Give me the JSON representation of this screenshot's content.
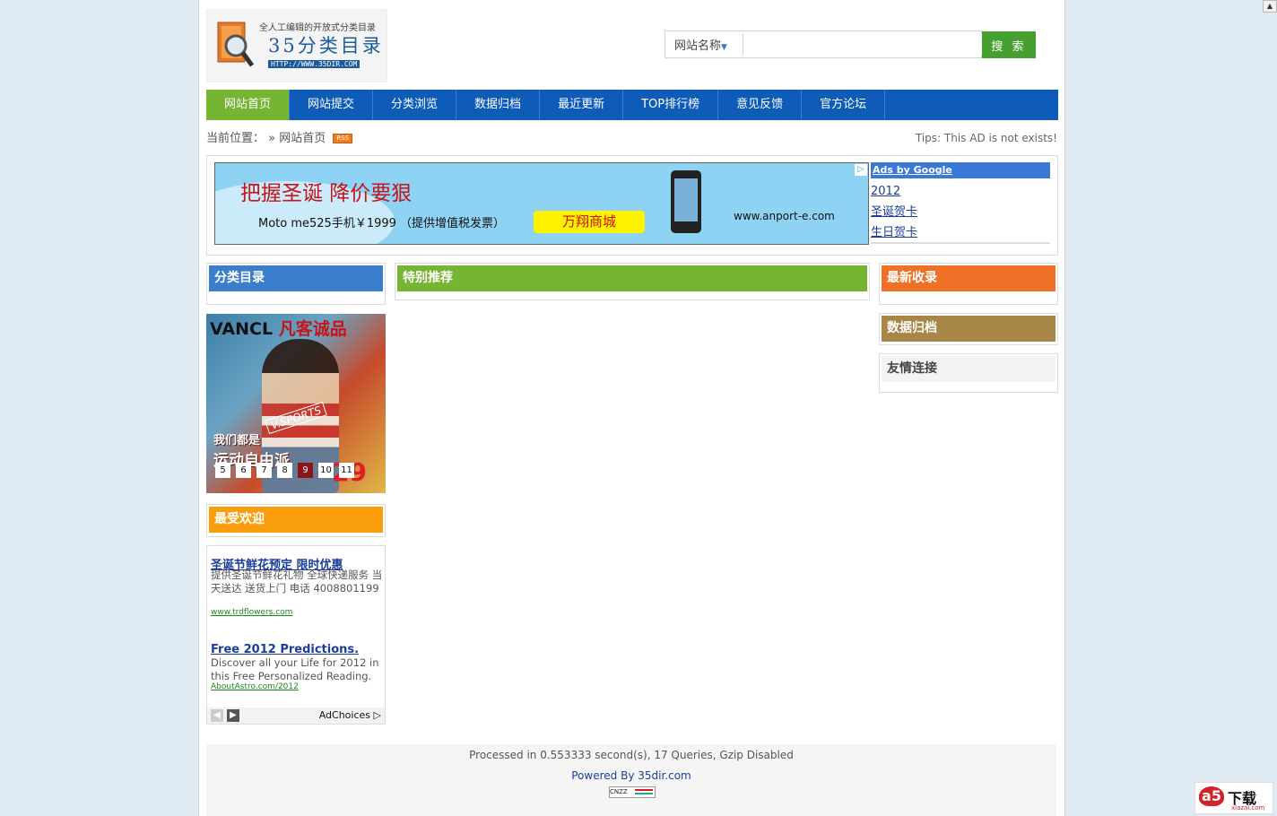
{
  "logo": {
    "slogan": "全人工编辑的开放式分类目录",
    "title": "35分类目录",
    "url": "HTTP://WWW.35DIR.COM"
  },
  "search": {
    "type_selected": "网站名称",
    "placeholder": "",
    "button": "搜 索"
  },
  "nav": {
    "items": [
      "网站首页",
      "网站提交",
      "分类浏览",
      "数据归档",
      "最近更新",
      "TOP排行榜",
      "意见反馈",
      "官方论坛"
    ]
  },
  "breadcrumb": {
    "label": "当前位置：",
    "sep": "»",
    "current": "网站首页",
    "rss": "RSS"
  },
  "tips": "Tips: This AD is not exists!",
  "banner_ad": {
    "headline": "把握圣诞  降价要狠",
    "subline": "Moto me525手机￥1999 （提供增值税发票）",
    "mall": "万翔商城",
    "url": "www.anport-e.com"
  },
  "google_ads": {
    "header": "Ads by Google",
    "links": [
      "2012",
      "圣诞贺卡",
      "生日贺卡"
    ]
  },
  "boxes": {
    "category": "分类目录",
    "featured": "特别推荐",
    "latest": "最新收录",
    "archive": "数据归档",
    "friends": "友情连接",
    "popular": "最受欢迎"
  },
  "vancl_ad": {
    "brand": "VANCL",
    "brand_cn": "凡客诚品",
    "sports": "V.SPORTS",
    "slogan_1": "我们都是",
    "slogan_2": "运动自由派",
    "price": "29",
    "pages": [
      "5",
      "6",
      "7",
      "8",
      "9",
      "10",
      "11"
    ],
    "active_page": "9"
  },
  "text_ads": [
    {
      "title": "圣诞节鲜花预定  限时优惠",
      "desc": "提供圣诞节鲜花礼物 全球快递服务 当天送达 送货上门 电话 4008801199",
      "url": "www.trdflowers.com"
    },
    {
      "title": "Free 2012 Predictions.",
      "desc": "Discover all your Life for 2012 in this Free Personalized Reading.",
      "url": "AboutAstro.com/2012"
    }
  ],
  "adchoices": "AdChoices",
  "footer": {
    "processed": "Processed in 0.553333 second(s), 17 Queries, Gzip Disabled",
    "powered": "Powered By 35dir.com",
    "badge": "CNZZ"
  },
  "corner_logo": {
    "mark": "a5",
    "text": "下载",
    "domain": "xiazai.com"
  },
  "colors": {
    "nav_bg": "#0e5cb8",
    "nav_active": "#76b532",
    "search_btn": "#45a02f",
    "title_blue": "#3b7fcc",
    "title_green": "#76b532",
    "title_orange": "#ee7127",
    "title_brown": "#a88648",
    "title_yellow": "#f99d0c"
  }
}
